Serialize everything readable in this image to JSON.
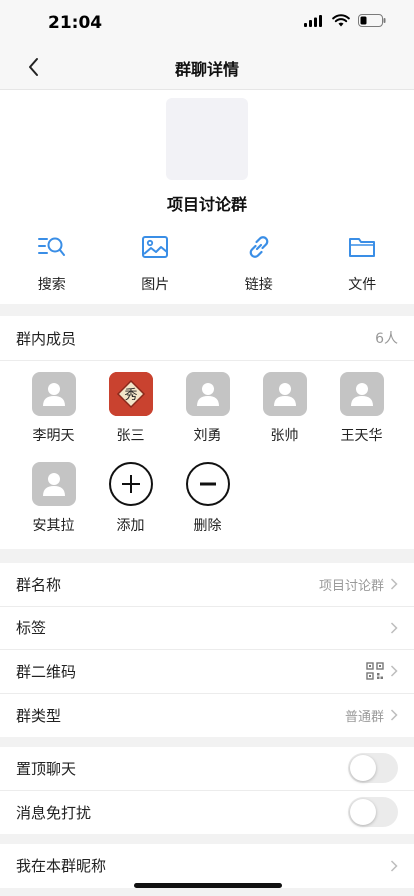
{
  "status": {
    "time": "21:04"
  },
  "nav": {
    "title": "群聊详情"
  },
  "group": {
    "name": "项目讨论群"
  },
  "tools": [
    {
      "label": "搜索",
      "icon": "search-icon"
    },
    {
      "label": "图片",
      "icon": "image-icon"
    },
    {
      "label": "链接",
      "icon": "link-icon"
    },
    {
      "label": "文件",
      "icon": "folder-icon"
    }
  ],
  "members": {
    "title": "群内成员",
    "count": "6人",
    "list": [
      {
        "name": "李明天"
      },
      {
        "name": "张三"
      },
      {
        "name": "刘勇"
      },
      {
        "name": "张帅"
      },
      {
        "name": "王天华"
      },
      {
        "name": "安其拉"
      }
    ],
    "add_label": "添加",
    "remove_label": "删除",
    "avatar_badge": "秀"
  },
  "settings": {
    "group_name": {
      "label": "群名称",
      "value": "项目讨论群"
    },
    "tags": {
      "label": "标签"
    },
    "qr_code": {
      "label": "群二维码"
    },
    "group_type": {
      "label": "群类型",
      "value": "普通群"
    },
    "pin_chat": {
      "label": "置顶聊天",
      "on": false
    },
    "mute": {
      "label": "消息免打扰",
      "on": false
    },
    "my_nickname": {
      "label": "我在本群昵称"
    }
  },
  "colors": {
    "accent": "#3a8ee6",
    "toggle_off": "#ebebeb"
  }
}
